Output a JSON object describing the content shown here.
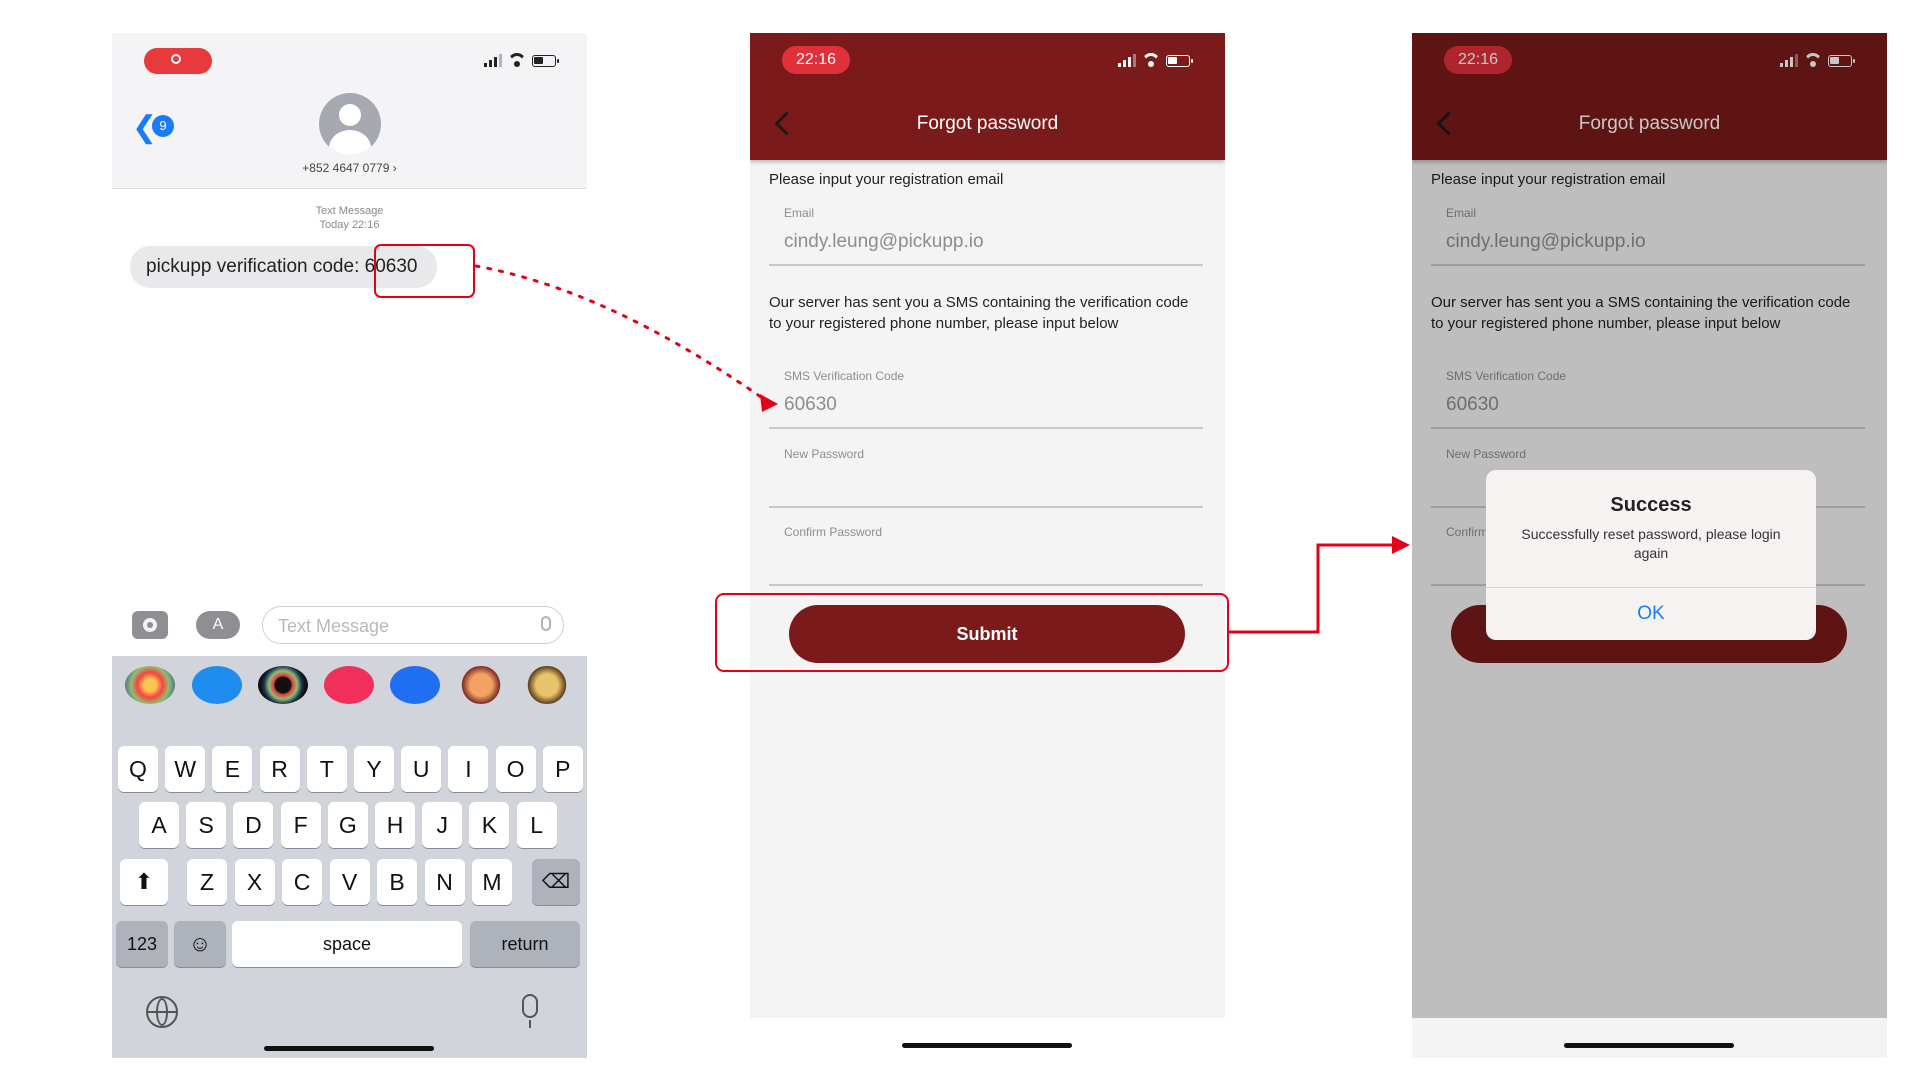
{
  "messages_screen": {
    "contact_number": "+852 4647 0779 ›",
    "back_badge": "9",
    "message_meta_line1": "Text Message",
    "message_meta_line2": "Today 22:16",
    "message_text": "pickupp verification code: 60630",
    "input_placeholder": "Text Message",
    "keyboard": {
      "row1": [
        "Q",
        "W",
        "E",
        "R",
        "T",
        "Y",
        "U",
        "I",
        "O",
        "P"
      ],
      "row2": [
        "A",
        "S",
        "D",
        "F",
        "G",
        "H",
        "J",
        "K",
        "L"
      ],
      "row3": [
        "Z",
        "X",
        "C",
        "V",
        "B",
        "N",
        "M"
      ],
      "numbers_key": "123",
      "space_key": "space",
      "return_key": "return"
    },
    "icons": [
      "record-icon",
      "back-chevron-icon",
      "avatar-icon",
      "camera-icon",
      "app-store-icon",
      "microphone-icon",
      "shift-icon",
      "backspace-icon",
      "emoji-icon",
      "globe-icon"
    ]
  },
  "forgot_screen": {
    "time": "22:16",
    "title": "Forgot password",
    "instruction": "Please input your registration email",
    "email_label": "Email",
    "email_value": "cindy.leung@pickupp.io",
    "sms_note": "Our server has sent you a SMS containing the verification code to your registered phone number, please input below",
    "sms_label": "SMS Verification Code",
    "sms_value": "60630",
    "new_password_label": "New Password",
    "confirm_password_label": "Confirm Password",
    "submit_label": "Submit"
  },
  "success_screen": {
    "time": "22:16",
    "title": "Forgot password",
    "instruction": "Please input your registration email",
    "email_label": "Email",
    "email_value": "cindy.leung@pickupp.io",
    "sms_note": "Our server has sent you a SMS containing the verification code to your registered phone number, please input below",
    "sms_label": "SMS Verification Code",
    "sms_value": "60630",
    "new_password_label": "New Password",
    "confirm_password_label": "Confirm Password",
    "dialog_title": "Success",
    "dialog_message": "Successfully reset password, please login again",
    "dialog_button": "OK"
  },
  "colors": {
    "brand_maroon": "#7a1a1a",
    "highlight_red": "#e4001b",
    "ios_blue": "#1a7cf5"
  }
}
